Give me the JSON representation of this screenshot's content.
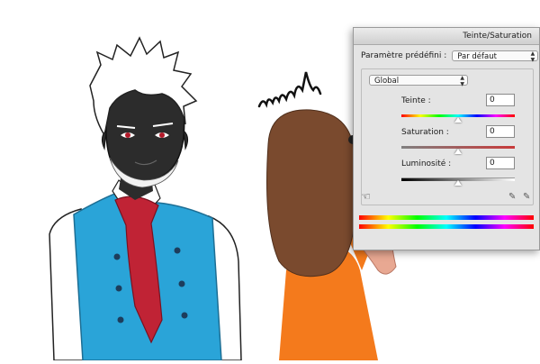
{
  "dialog": {
    "title": "Teinte/Saturation",
    "preset": {
      "label": "Paramètre prédéfini :",
      "value": "Par défaut"
    },
    "channel": {
      "value": "Global"
    },
    "hue": {
      "label": "Teinte :",
      "value": "0",
      "position": 0.5
    },
    "saturation": {
      "label": "Saturation :",
      "value": "0",
      "position": 0.5
    },
    "lightness": {
      "label": "Luminosité :",
      "value": "0",
      "position": 0.5
    }
  },
  "artwork": {
    "speech_text": "mmh"
  },
  "icons": {
    "hand": "hand-tool-icon",
    "eyedropper_plus": "eyedropper-plus-icon",
    "eyedropper_minus": "eyedropper-minus-icon"
  },
  "colors": {
    "vest": "#2aa4d8",
    "tie": "#c02335",
    "skin_dark": "#2c2c2c",
    "hair_girl": "#7a4a2e",
    "dress": "#f47a1c"
  }
}
